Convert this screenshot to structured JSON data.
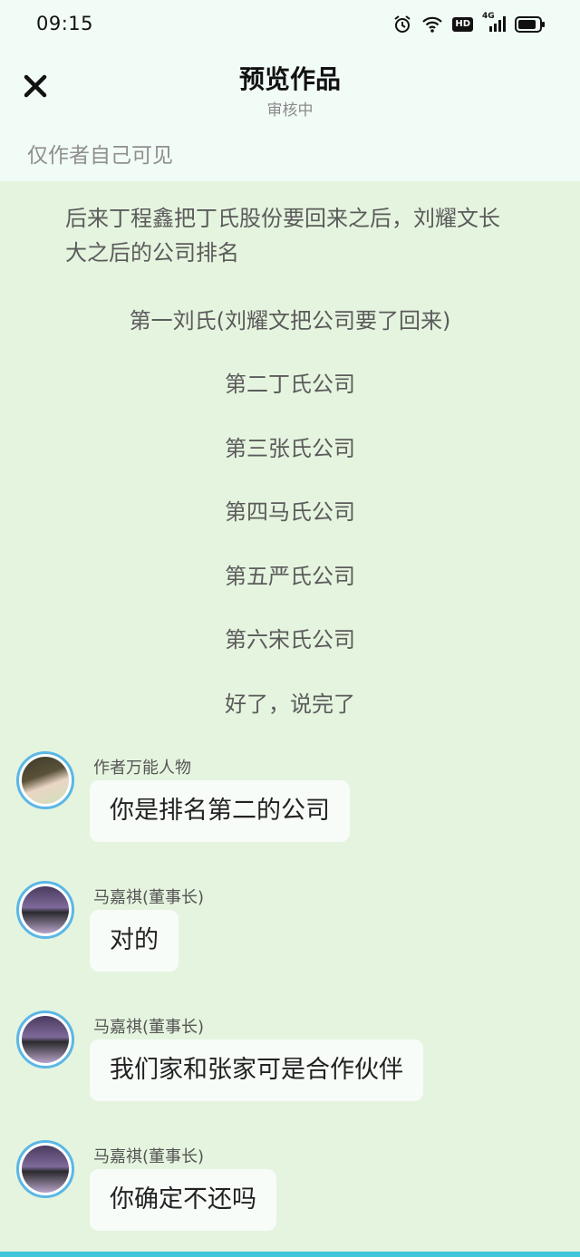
{
  "status_bar": {
    "time": "09:15",
    "hd": "HD",
    "net": "4G"
  },
  "header": {
    "title": "预览作品",
    "subtitle": "审核中"
  },
  "visibility_note": "仅作者自己可见",
  "story": {
    "intro": "后来丁程鑫把丁氏股份要回来之后，刘耀文长大之后的公司排名",
    "lines": [
      "第一刘氏(刘耀文把公司要了回来)",
      "第二丁氏公司",
      "第三张氏公司",
      "第四马氏公司",
      "第五严氏公司",
      "第六宋氏公司",
      "好了，说完了"
    ]
  },
  "messages": [
    {
      "sender": "作者万能人物",
      "text": "你是排名第二的公司"
    },
    {
      "sender": "马嘉祺(董事长)",
      "text": "对的"
    },
    {
      "sender": "马嘉祺(董事长)",
      "text": "我们家和张家可是合作伙伴"
    },
    {
      "sender": "马嘉祺(董事长)",
      "text": "你确定不还吗"
    }
  ],
  "colors": {
    "background": "#e5f4df",
    "header_bg": "#f2fcf6",
    "avatar_ring": "#5bb7e6",
    "bubble": "#f8fcf8",
    "bottom_bar": "#3fc6d9"
  }
}
